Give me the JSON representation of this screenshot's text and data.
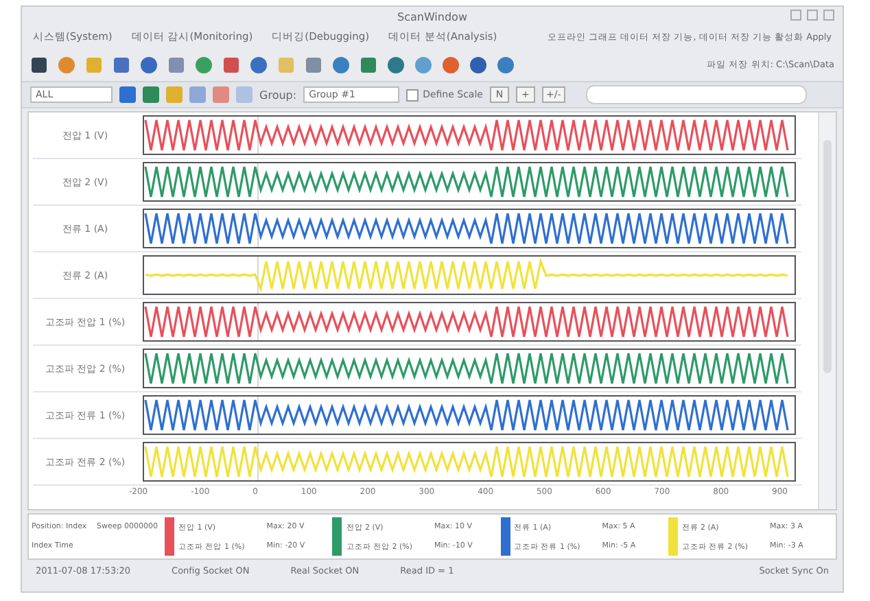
{
  "window": {
    "title": "ScanWindow"
  },
  "menu": [
    {
      "label": "시스템(System)"
    },
    {
      "label": "데이터 감시(Monitoring)"
    },
    {
      "label": "디버깅(Debugging)"
    },
    {
      "label": "데이터 분석(Analysis)"
    }
  ],
  "menu_note": "오프라인 그래프 데이터 저장 기능, 데이터 저장 기능 활성화 Apply",
  "toolbar_note": "파일 저장 위치: C:\\Scan\\Data",
  "filter": {
    "channel": "ALL",
    "group_label": "Group:",
    "group": "Group #1",
    "define_scale": {
      "label": "Define Scale",
      "checked": false
    },
    "buttons": [
      "N",
      "+",
      "+/-"
    ]
  },
  "channels": [
    {
      "label": "전압 1 (V)",
      "color": "#e8505a",
      "kind": "steady"
    },
    {
      "label": "전압 2 (V)",
      "color": "#2e9a68",
      "kind": "steady"
    },
    {
      "label": "전류 1 (A)",
      "color": "#2f6fd0",
      "kind": "steady"
    },
    {
      "label": "전류 2 (A)",
      "color": "#f0e23a",
      "kind": "burst"
    },
    {
      "label": "고조파 전압 1 (%)",
      "color": "#e8505a",
      "kind": "steady"
    },
    {
      "label": "고조파 전압 2 (%)",
      "color": "#2e9a68",
      "kind": "steady"
    },
    {
      "label": "고조파 전류 1 (%)",
      "color": "#2f6fd0",
      "kind": "steady"
    },
    {
      "label": "고조파 전류 2 (%)",
      "color": "#f0e23a",
      "kind": "steady"
    }
  ],
  "x_ticks": [
    "-200",
    "-100",
    "0",
    "100",
    "200",
    "300",
    "400",
    "500",
    "600",
    "700",
    "800",
    "900"
  ],
  "legend": {
    "position": "Position: Index",
    "sweep": "Sweep 0000000",
    "time": "Index Time",
    "entries": [
      {
        "color": "#e8505a",
        "name": "전압 1 (V)",
        "detail": "고조파 전압 1 (%)",
        "stat_1": "Max: 20 V",
        "stat_2": "Min: -20 V"
      },
      {
        "color": "#2e9a68",
        "name": "전압 2 (V)",
        "detail": "고조파 전압 2 (%)",
        "stat_1": "Max: 10 V",
        "stat_2": "Min: -10 V"
      },
      {
        "color": "#2f6fd0",
        "name": "전류 1 (A)",
        "detail": "고조파 전류 1 (%)",
        "stat_1": "Max: 5 A",
        "stat_2": "Min: -5 A"
      },
      {
        "color": "#f0e23a",
        "name": "전류 2 (A)",
        "detail": "고조파 전류 2 (%)",
        "stat_1": "Max: 3 A",
        "stat_2": "Min: -3 A"
      }
    ]
  },
  "status_bar": [
    "2011-07-08 17:53:20",
    "Config Socket ON",
    "Real Socket ON",
    "Read ID = 1",
    "Socket Sync On"
  ]
}
